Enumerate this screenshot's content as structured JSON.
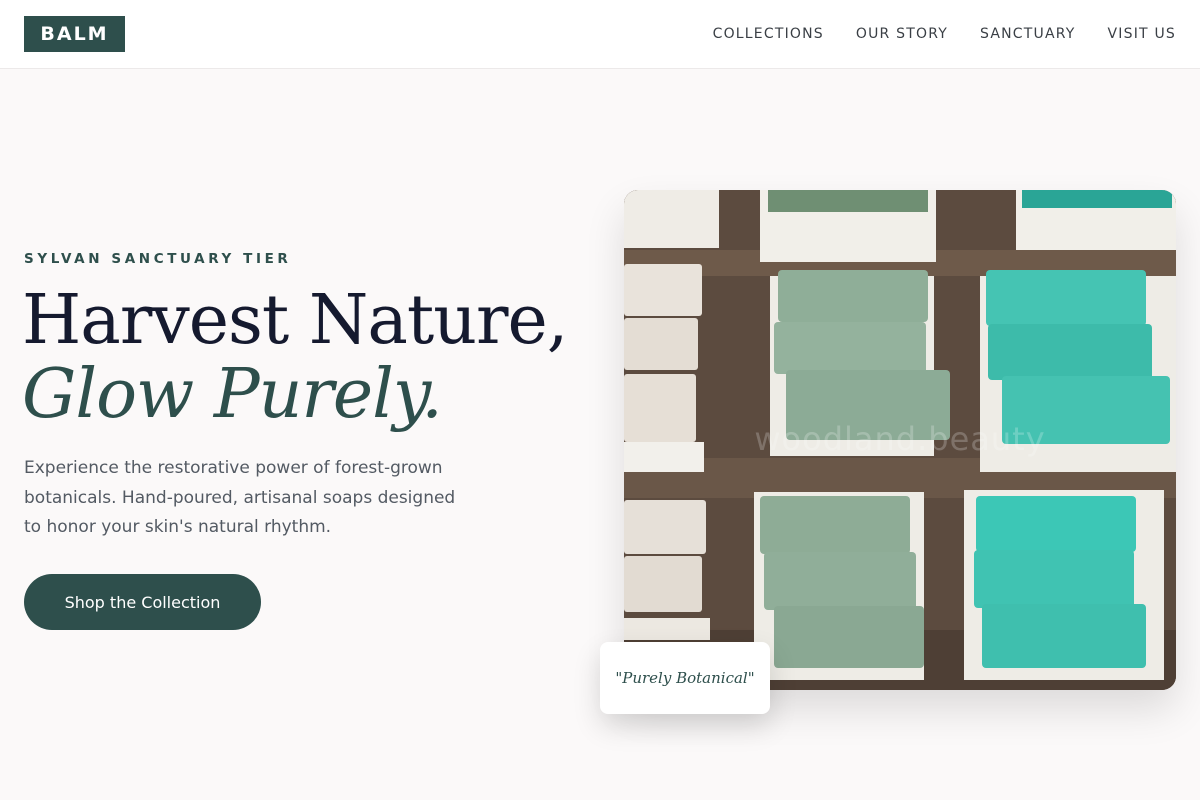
{
  "header": {
    "logo": "BALM",
    "nav": [
      "COLLECTIONS",
      "OUR STORY",
      "SANCTUARY",
      "VISIT US"
    ]
  },
  "hero": {
    "eyebrow": "SYLVAN SANCTUARY TIER",
    "headline_line1": "Harvest Nature,",
    "headline_line2": "Glow Purely.",
    "subcopy": "Experience the restorative power of forest-grown botanicals. Hand-poured, artisanal soaps designed to honor your skin's natural rhythm.",
    "cta_label": "Shop the Collection"
  },
  "image": {
    "watermark": "woodland.beauty",
    "badge": "\"Purely Botanical\""
  },
  "colors": {
    "brand": "#2e4f4c",
    "background": "#fbf9f9",
    "headline": "#151a2f",
    "body_text": "#535a63"
  }
}
